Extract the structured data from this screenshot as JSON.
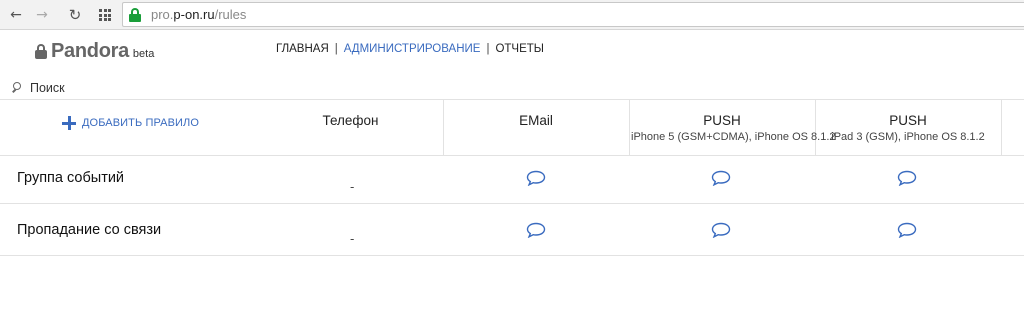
{
  "browser": {
    "url_prefix": "pro.",
    "url_domain": "p-on.ru",
    "url_path": "/rules"
  },
  "header": {
    "logo_text": "Pandora",
    "logo_badge": "beta",
    "nav": [
      {
        "label": "ГЛАВНАЯ",
        "active": false
      },
      {
        "label": "АДМИНИСТРИРОВАНИЕ",
        "active": true
      },
      {
        "label": "ОТЧЕТЫ",
        "active": false
      }
    ],
    "nav_separator": "|"
  },
  "search": {
    "label": "Поиск"
  },
  "table": {
    "add_rule_label": "ДОБАВИТЬ ПРАВИЛО",
    "columns": [
      {
        "title": "Телефон",
        "subtitle": ""
      },
      {
        "title": "EMail",
        "subtitle": ""
      },
      {
        "title": "PUSH",
        "subtitle": "iPhone 5 (GSM+CDMA), iPhone OS 8.1.2"
      },
      {
        "title": "PUSH",
        "subtitle": "iPad 3 (GSM), iPhone OS 8.1.2"
      }
    ],
    "rows": [
      {
        "label": "Группа событий",
        "phone": "-"
      },
      {
        "label": "Пропадание со связи",
        "phone": "-"
      }
    ]
  },
  "colors": {
    "accent": "#3a6bbf",
    "lock_green": "#1a9e3a",
    "logo_gray": "#666666"
  },
  "icons": [
    "back-arrow-icon",
    "forward-arrow-icon",
    "reload-icon",
    "apps-icon",
    "lock-icon",
    "search-icon",
    "plus-icon",
    "speech-bubble-icon"
  ]
}
